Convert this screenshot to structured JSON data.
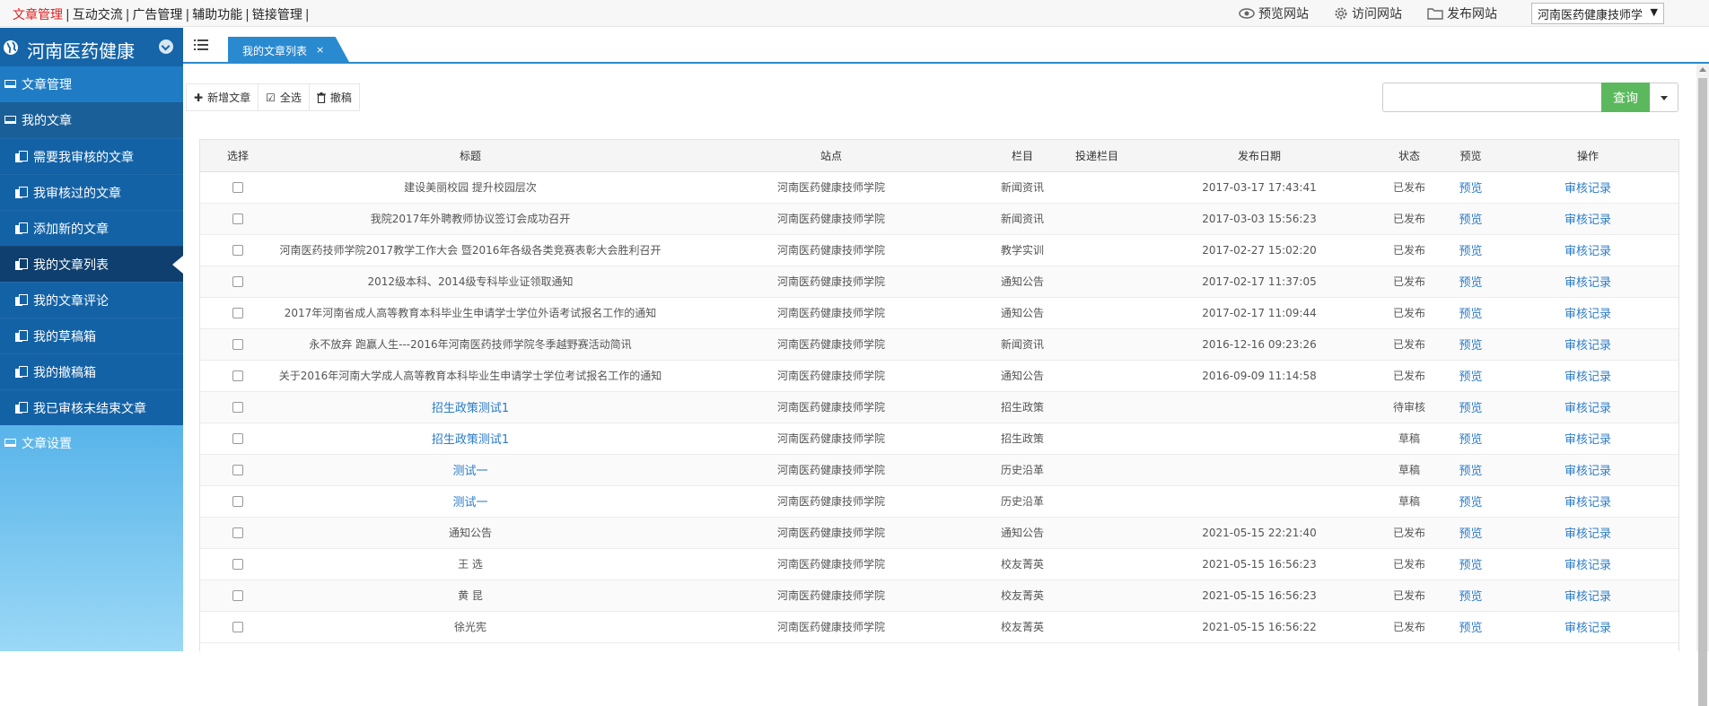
{
  "topmenu": {
    "items": [
      "文章管理",
      "互动交流",
      "广告管理",
      "辅助功能",
      "链接管理"
    ],
    "active_index": 0
  },
  "toplinks": {
    "preview": "预览网站",
    "visit": "访问网站",
    "publish": "发布网站",
    "site_select": "河南医药健康技师学"
  },
  "sidebar": {
    "title": "河南医药健康",
    "items": [
      {
        "label": "文章管理",
        "kind": "top"
      },
      {
        "label": "我的文章",
        "kind": "top"
      },
      {
        "label": "需要我审核的文章",
        "kind": "sub"
      },
      {
        "label": "我审核过的文章",
        "kind": "sub"
      },
      {
        "label": "添加新的文章",
        "kind": "sub"
      },
      {
        "label": "我的文章列表",
        "kind": "sub",
        "active": true
      },
      {
        "label": "我的文章评论",
        "kind": "sub"
      },
      {
        "label": "我的草稿箱",
        "kind": "sub"
      },
      {
        "label": "我的撤稿箱",
        "kind": "sub"
      },
      {
        "label": "我已审核未结束文章",
        "kind": "sub"
      },
      {
        "label": "文章设置",
        "kind": "top"
      }
    ]
  },
  "tab": {
    "label": "我的文章列表",
    "close": "×"
  },
  "toolbar": {
    "add": "新增文章",
    "select_all": "全选",
    "withdraw": "撤稿"
  },
  "search": {
    "placeholder": "",
    "button": "查询"
  },
  "table": {
    "headers": [
      "选择",
      "标题",
      "站点",
      "栏目",
      "投递栏目",
      "发布日期",
      "状态",
      "预览",
      "操作"
    ],
    "preview_label": "预览",
    "action_label": "审核记录",
    "rows": [
      {
        "title": "建设美丽校园 提升校园层次",
        "site": "河南医药健康技师学院",
        "column": "新闻资讯",
        "delivery": "",
        "date": "2017-03-17 17:43:41",
        "status": "已发布",
        "link": false
      },
      {
        "title": "我院2017年外聘教师协议签订会成功召开",
        "site": "河南医药健康技师学院",
        "column": "新闻资讯",
        "delivery": "",
        "date": "2017-03-03 15:56:23",
        "status": "已发布",
        "link": false
      },
      {
        "title": "河南医药技师学院2017教学工作大会 暨2016年各级各类竞赛表彰大会胜利召开",
        "site": "河南医药健康技师学院",
        "column": "教学实训",
        "delivery": "",
        "date": "2017-02-27 15:02:20",
        "status": "已发布",
        "link": false
      },
      {
        "title": "2012级本科、2014级专科毕业证领取通知",
        "site": "河南医药健康技师学院",
        "column": "通知公告",
        "delivery": "",
        "date": "2017-02-17 11:37:05",
        "status": "已发布",
        "link": false
      },
      {
        "title": "2017年河南省成人高等教育本科毕业生申请学士学位外语考试报名工作的通知",
        "site": "河南医药健康技师学院",
        "column": "通知公告",
        "delivery": "",
        "date": "2017-02-17 11:09:44",
        "status": "已发布",
        "link": false
      },
      {
        "title": "永不放弃 跑赢人生---2016年河南医药技师学院冬季越野赛活动简讯",
        "site": "河南医药健康技师学院",
        "column": "新闻资讯",
        "delivery": "",
        "date": "2016-12-16 09:23:26",
        "status": "已发布",
        "link": false
      },
      {
        "title": "关于2016年河南大学成人高等教育本科毕业生申请学士学位考试报名工作的通知",
        "site": "河南医药健康技师学院",
        "column": "通知公告",
        "delivery": "",
        "date": "2016-09-09 11:14:58",
        "status": "已发布",
        "link": false
      },
      {
        "title": "招生政策测试1",
        "site": "河南医药健康技师学院",
        "column": "招生政策",
        "delivery": "",
        "date": "",
        "status": "待审核",
        "link": true
      },
      {
        "title": "招生政策测试1",
        "site": "河南医药健康技师学院",
        "column": "招生政策",
        "delivery": "",
        "date": "",
        "status": "草稿",
        "link": true
      },
      {
        "title": "测试一",
        "site": "河南医药健康技师学院",
        "column": "历史沿革",
        "delivery": "",
        "date": "",
        "status": "草稿",
        "link": true
      },
      {
        "title": "测试一",
        "site": "河南医药健康技师学院",
        "column": "历史沿革",
        "delivery": "",
        "date": "",
        "status": "草稿",
        "link": true
      },
      {
        "title": "通知公告",
        "site": "河南医药健康技师学院",
        "column": "通知公告",
        "delivery": "",
        "date": "2021-05-15 22:21:40",
        "status": "已发布",
        "link": false
      },
      {
        "title": "王 选",
        "site": "河南医药健康技师学院",
        "column": "校友菁英",
        "delivery": "",
        "date": "2021-05-15 16:56:23",
        "status": "已发布",
        "link": false
      },
      {
        "title": "黄 昆",
        "site": "河南医药健康技师学院",
        "column": "校友菁英",
        "delivery": "",
        "date": "2021-05-15 16:56:23",
        "status": "已发布",
        "link": false
      },
      {
        "title": "徐光宪",
        "site": "河南医药健康技师学院",
        "column": "校友菁英",
        "delivery": "",
        "date": "2021-05-15 16:56:22",
        "status": "已发布",
        "link": false
      }
    ]
  },
  "colors": {
    "accent": "#2a8ad0",
    "sidebar_dark": "#1565a8",
    "active_menu": "#e02020",
    "search_green": "#5cb85c",
    "link": "#2c7cc8"
  }
}
